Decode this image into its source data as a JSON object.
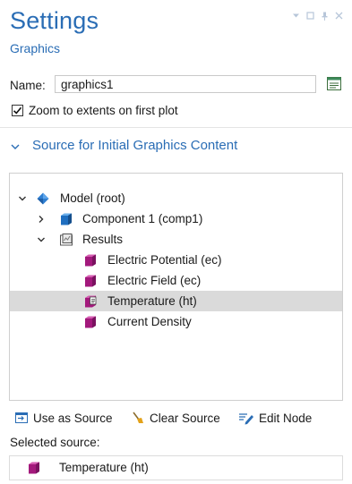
{
  "panel": {
    "title": "Settings",
    "subtitle": "Graphics",
    "window_controls": [
      "chevron-down-icon",
      "maximize-icon",
      "pin-icon",
      "close-icon"
    ]
  },
  "name_field": {
    "label": "Name:",
    "value": "graphics1"
  },
  "zoom_checkbox": {
    "label": "Zoom to extents on first plot",
    "checked": true
  },
  "section": {
    "title": "Source for Initial Graphics Content",
    "expanded": true
  },
  "tree": {
    "items": [
      {
        "label": "Model (root)",
        "icon": "model-root-icon",
        "expanded": true,
        "selected": false
      },
      {
        "label": "Component 1 (comp1)",
        "icon": "component-icon",
        "expanded": false,
        "selected": false
      },
      {
        "label": "Results",
        "icon": "results-icon",
        "expanded": true,
        "selected": false
      },
      {
        "label": "Electric Potential (ec)",
        "icon": "plot-group-icon",
        "selected": false
      },
      {
        "label": "Electric Field (ec)",
        "icon": "plot-group-icon",
        "selected": false
      },
      {
        "label": "Temperature (ht)",
        "icon": "plot-group-doc-icon",
        "selected": true
      },
      {
        "label": "Current Density",
        "icon": "plot-group-icon",
        "selected": false
      }
    ]
  },
  "toolbar": {
    "use_as_source": "Use as Source",
    "clear_source": "Clear Source",
    "edit_node": "Edit Node"
  },
  "selected_source": {
    "label": "Selected source:",
    "value": "Temperature (ht)"
  },
  "colors": {
    "accent": "#2a6db5",
    "plot_group": "#a3197c",
    "selection": "#dadada"
  }
}
